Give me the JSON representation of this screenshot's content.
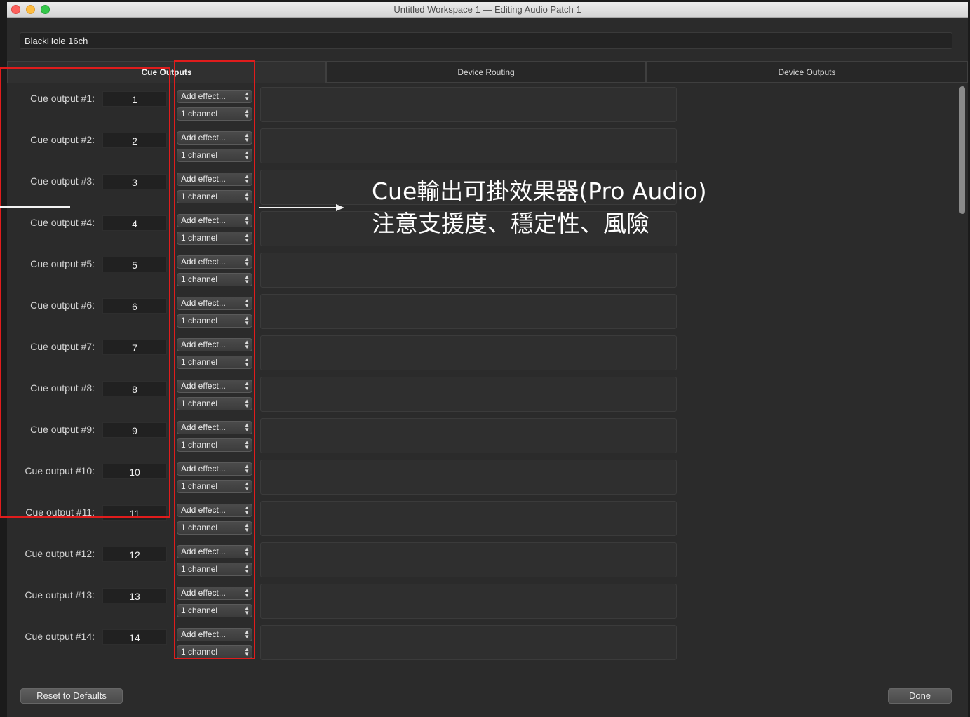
{
  "window": {
    "title": "Untitled Workspace 1 — Editing Audio Patch 1"
  },
  "device": {
    "name": "BlackHole 16ch"
  },
  "tabs": [
    {
      "label": "Cue Outputs",
      "selected": true
    },
    {
      "label": "Device Routing",
      "selected": false
    },
    {
      "label": "Device Outputs",
      "selected": false
    }
  ],
  "cue_outputs": [
    {
      "label": "Cue output #1:",
      "number": "1",
      "effect": "Add effect...",
      "channels": "1 channel"
    },
    {
      "label": "Cue output #2:",
      "number": "2",
      "effect": "Add effect...",
      "channels": "1 channel"
    },
    {
      "label": "Cue output #3:",
      "number": "3",
      "effect": "Add effect...",
      "channels": "1 channel"
    },
    {
      "label": "Cue output #4:",
      "number": "4",
      "effect": "Add effect...",
      "channels": "1 channel"
    },
    {
      "label": "Cue output #5:",
      "number": "5",
      "effect": "Add effect...",
      "channels": "1 channel"
    },
    {
      "label": "Cue output #6:",
      "number": "6",
      "effect": "Add effect...",
      "channels": "1 channel"
    },
    {
      "label": "Cue output #7:",
      "number": "7",
      "effect": "Add effect...",
      "channels": "1 channel"
    },
    {
      "label": "Cue output #8:",
      "number": "8",
      "effect": "Add effect...",
      "channels": "1 channel"
    },
    {
      "label": "Cue output #9:",
      "number": "9",
      "effect": "Add effect...",
      "channels": "1 channel"
    },
    {
      "label": "Cue output #10:",
      "number": "10",
      "effect": "Add effect...",
      "channels": "1 channel"
    },
    {
      "label": "Cue output #11:",
      "number": "11",
      "effect": "Add effect...",
      "channels": "1 channel"
    },
    {
      "label": "Cue output #12:",
      "number": "12",
      "effect": "Add effect...",
      "channels": "1 channel"
    },
    {
      "label": "Cue output #13:",
      "number": "13",
      "effect": "Add effect...",
      "channels": "1 channel"
    },
    {
      "label": "Cue output #14:",
      "number": "14",
      "effect": "Add effect...",
      "channels": "1 channel"
    }
  ],
  "footer": {
    "reset_label": "Reset to Defaults",
    "done_label": "Done"
  },
  "annotation": {
    "line1": "Cue輸出可掛效果器(Pro Audio)",
    "line2": "注意支援度、穩定性、風險",
    "highlight_color": "#e01c1c"
  },
  "icons": {
    "popup": "up-down-chevron-icon"
  }
}
